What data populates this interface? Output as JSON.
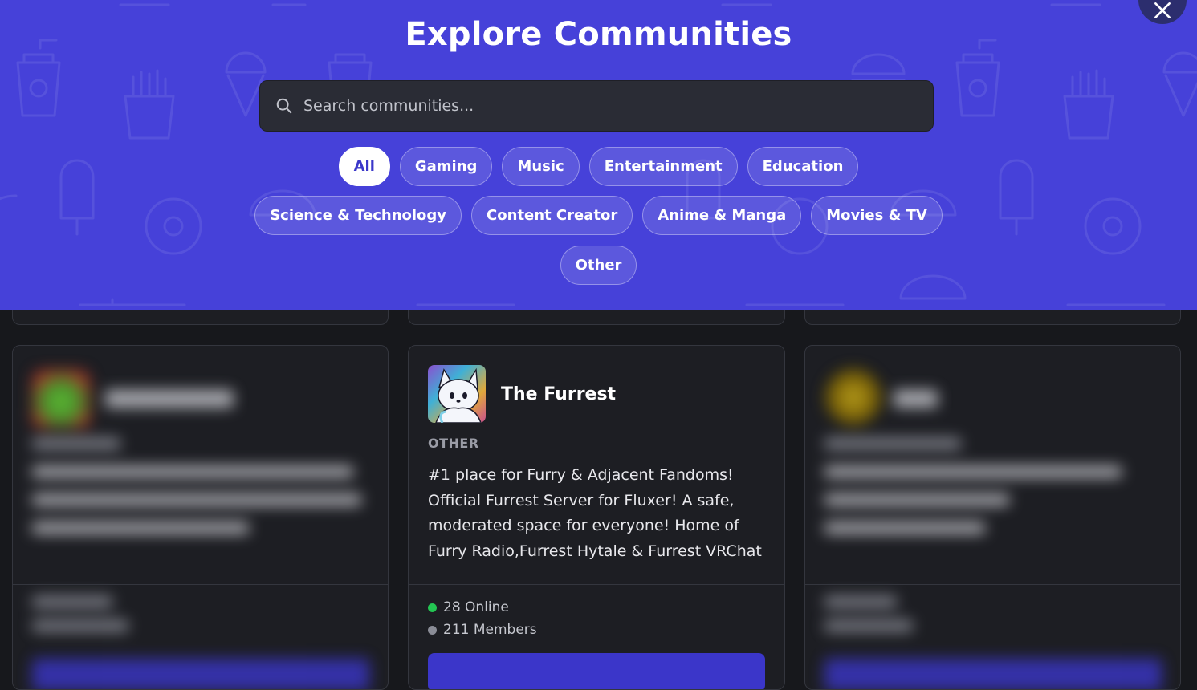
{
  "header": {
    "title": "Explore Communities",
    "close_icon": "close-icon"
  },
  "search": {
    "placeholder": "Search communities...",
    "icon": "search-icon"
  },
  "categories": [
    {
      "label": "All",
      "active": true
    },
    {
      "label": "Gaming"
    },
    {
      "label": "Music"
    },
    {
      "label": "Entertainment"
    },
    {
      "label": "Education"
    },
    {
      "label": "Science & Technology"
    },
    {
      "label": "Content Creator"
    },
    {
      "label": "Anime & Manga"
    },
    {
      "label": "Movies & TV"
    },
    {
      "label": "Other"
    }
  ],
  "featured": {
    "name": "The Furrest",
    "category": "OTHER",
    "description": "#1 place for Furry & Adjacent Fandoms! Official Furrest Server for Fluxer! A safe, moderated space for everyone! Home of Furry Radio,Furrest Hytale & Furrest VRChat",
    "online": "28 Online",
    "members": "211 Members"
  },
  "colors": {
    "brand": "#4641d9",
    "online": "#23c552",
    "members": "#8a8c96",
    "button": "#3b36c9"
  }
}
